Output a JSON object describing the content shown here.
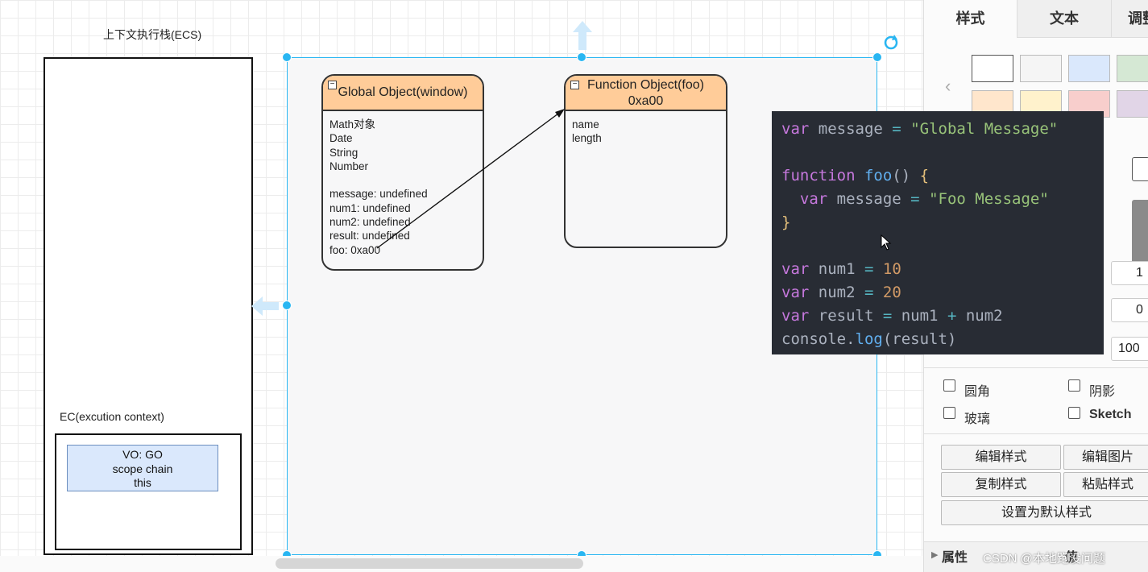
{
  "canvas": {
    "ecs_title": "上下文执行栈(ECS)",
    "ec_title": "EC(excution context)",
    "vo_lines": [
      "VO: GO",
      "scope chain",
      "this"
    ],
    "global_object": {
      "title": "Global Object(window)",
      "body": "Math对象\nDate\nString\nNumber\n\nmessage: undefined\nnum1: undefined\nnum2: undefined\nresult: undefined\nfoo: 0xa00"
    },
    "function_object": {
      "title_line1": "Function Object(foo)",
      "title_line2": "0xa00",
      "body": "name\nlength"
    },
    "accent_color": "#29b6f2"
  },
  "code": {
    "lines": [
      "var message = \"Global Message\"",
      "",
      "function foo() {",
      "  var message = \"Foo Message\"",
      "}",
      "",
      "var num1 = 10",
      "var num2 = 20",
      "var result = num1 + num2",
      "console.log(result)"
    ]
  },
  "panel": {
    "tabs": [
      "样式",
      "文本",
      "调整"
    ],
    "swatch_colors": [
      "#ffffff",
      "#f5f5f5",
      "#dae8fc",
      "#d5e8d4",
      "#ffe6cc",
      "#fff2cc",
      "#f8cecc",
      "#e1d5e7"
    ],
    "field_values": [
      "1",
      "0",
      "100"
    ],
    "checkboxes": [
      "圆角",
      "阴影",
      "玻璃",
      "Sketch"
    ],
    "buttons": {
      "edit_style": "编辑样式",
      "edit_image": "编辑图片",
      "copy_style": "复制样式",
      "paste_style": "粘贴样式",
      "set_default": "设置为默认样式"
    },
    "properties_label": "属性",
    "value_label": "值",
    "watermark": "CSDN @本地跑没问题"
  }
}
